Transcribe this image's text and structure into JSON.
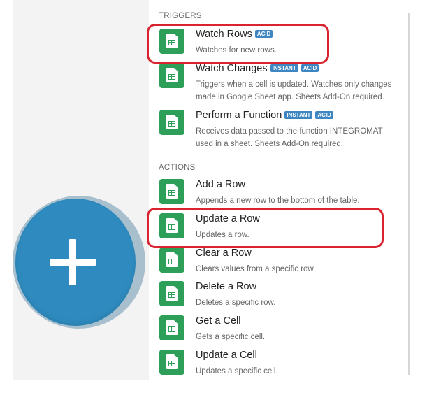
{
  "sections": {
    "triggers": "TRIGGERS",
    "actions": "ACTIONS"
  },
  "triggers": [
    {
      "title": "Watch Rows",
      "badges": [
        "ACID"
      ],
      "description": "Watches for new rows.",
      "highlighted": true
    },
    {
      "title": "Watch Changes",
      "badges": [
        "INSTANT",
        "ACID"
      ],
      "description": "Triggers when a cell is updated. Watches only changes made in Google Sheet app. Sheets Add-On required.",
      "highlighted": false
    },
    {
      "title": "Perform a Function",
      "badges": [
        "INSTANT",
        "ACID"
      ],
      "description": "Receives data passed to the function INTEGROMAT used in a sheet. Sheets Add-On required.",
      "highlighted": false
    }
  ],
  "actions": [
    {
      "title": "Add a Row",
      "description": "Appends a new row to the bottom of the table.",
      "highlighted": false
    },
    {
      "title": "Update a Row",
      "description": "Updates a row.",
      "highlighted": true
    },
    {
      "title": "Clear a Row",
      "description": "Clears values from a specific row.",
      "highlighted": false
    },
    {
      "title": "Delete a Row",
      "description": "Deletes a specific row.",
      "highlighted": false
    },
    {
      "title": "Get a Cell",
      "description": "Gets a specific cell.",
      "highlighted": false
    },
    {
      "title": "Update a Cell",
      "description": "Updates a specific cell.",
      "highlighted": false
    }
  ],
  "icons": {
    "module_icon": "google-sheets-icon",
    "add_icon": "plus-icon"
  },
  "colors": {
    "add_button": "#2f8bbf",
    "sheets_icon": "#2e9f58",
    "badge": "#3e86c2",
    "highlight": "#d9242f"
  }
}
